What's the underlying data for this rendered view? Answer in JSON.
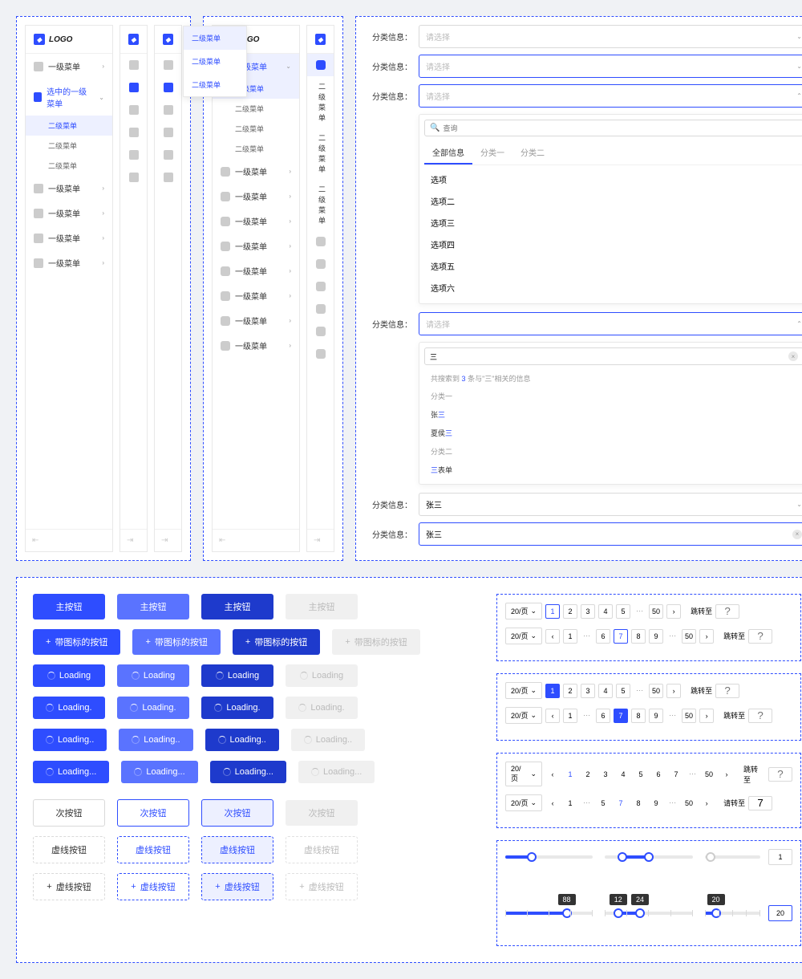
{
  "logo": "LOGO",
  "menu1": {
    "items": [
      "一级菜单",
      "选中的一级菜单",
      "一级菜单",
      "一级菜单",
      "一级菜单",
      "一级菜单"
    ],
    "subs": [
      "二级菜单",
      "二级菜单",
      "二级菜单"
    ]
  },
  "menu2": {
    "items": [
      "一级菜单",
      "一级菜单",
      "一级菜单",
      "一级菜单",
      "一级菜单",
      "一级菜单",
      "一级菜单",
      "一级菜单",
      "一级菜单"
    ],
    "subs": [
      "二级菜单",
      "二级菜单",
      "二级菜单",
      "二级菜单"
    ]
  },
  "flyout": [
    "二级菜单",
    "二级菜单",
    "二级菜单"
  ],
  "iconMenu": [
    "二级菜单",
    "二级菜单",
    "二级菜单"
  ],
  "form": {
    "label": "分类信息",
    "placeholder": "请选择",
    "searchPlaceholder": "查询",
    "tabs": [
      "全部信息",
      "分类一",
      "分类二"
    ],
    "options": [
      "选项",
      "选项二",
      "选项三",
      "选项四",
      "选项五",
      "选项六"
    ],
    "searchVal": "三",
    "searchHint1": "共搜索到",
    "searchHint2": "条与",
    "searchHint3": "相关的信息",
    "searchCount": "3",
    "cat1": "分类一",
    "cat2": "分类二",
    "result1a": "张",
    "result1b": "三",
    "result2a": "夏侯",
    "result2b": "三",
    "result3a": "三",
    "result3b": "表单",
    "selectedValue": "张三"
  },
  "buttons": {
    "primary": "主按钮",
    "iconBtn": "带图标的按钮",
    "loading": "Loading",
    "loading1": "Loading.",
    "loading2": "Loading..",
    "loading3": "Loading...",
    "secondary": "次按钮",
    "dashed": "虚线按钮"
  },
  "pagination": {
    "perPage": "20/页",
    "jumpLabel": "跳转至",
    "jumpLabel2": "请转至",
    "pages": [
      "1",
      "2",
      "3",
      "4",
      "5",
      "6",
      "7",
      "8",
      "9",
      "50"
    ],
    "placeholder": "?"
  },
  "sliders": {
    "v1": "1",
    "v2": "20",
    "l1": "88",
    "l2": "12",
    "l3": "24",
    "l4": "20"
  }
}
